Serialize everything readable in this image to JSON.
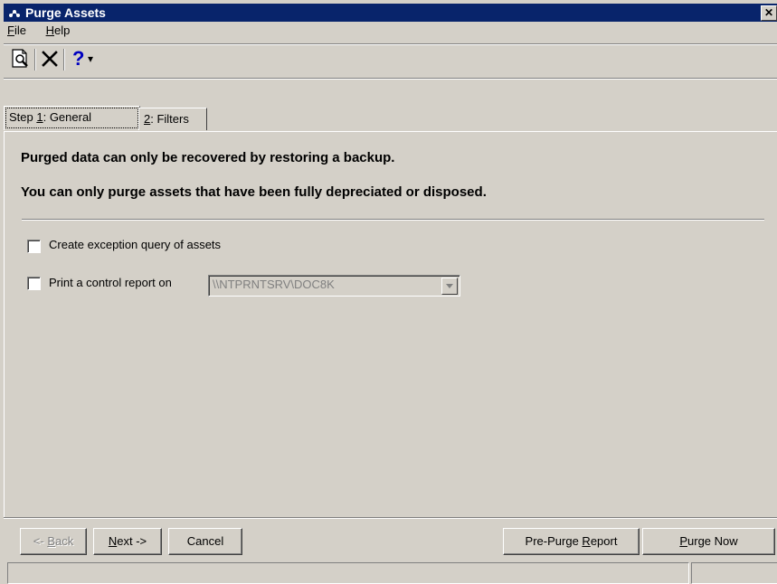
{
  "window": {
    "title": "Purge Assets",
    "close_glyph": "✕"
  },
  "menu": [
    {
      "label": "File",
      "mnemonic": "F",
      "rest": "ile"
    },
    {
      "label": "Help",
      "mnemonic": "H",
      "rest": "elp"
    }
  ],
  "toolbar": {
    "icons": [
      "print-preview-icon",
      "delete-icon",
      "help-icon",
      "dropdown-arrow-icon"
    ],
    "help_glyph": "?",
    "dropdown_glyph": "▾"
  },
  "tabs": [
    {
      "pre": "Step ",
      "mnemonic": "1",
      "post": ": General",
      "active": true
    },
    {
      "pre": "",
      "mnemonic": "2",
      "post": ": Filters",
      "active": false
    }
  ],
  "messages": [
    "Purged data can only be recovered by restoring a backup.",
    "You can only purge assets that have been fully depreciated or disposed."
  ],
  "options": {
    "exception_query_label": "Create exception query of assets",
    "control_report_label": "Print a control report on",
    "printer_value": "\\\\NTPRNTSRV\\DOC8K"
  },
  "buttons": {
    "back": {
      "pre": "<- ",
      "mnemonic": "B",
      "post": "ack"
    },
    "next": {
      "pre": "",
      "mnemonic": "N",
      "post": "ext ->"
    },
    "cancel": "Cancel",
    "prepurge": {
      "pre": "Pre-Purge ",
      "mnemonic": "R",
      "post": "eport"
    },
    "purge": {
      "pre": "",
      "mnemonic": "P",
      "post": "urge Now"
    }
  },
  "colors": {
    "titlebar": "#08246b",
    "face": "#d4d0c8",
    "help_icon": "#0000c0"
  }
}
